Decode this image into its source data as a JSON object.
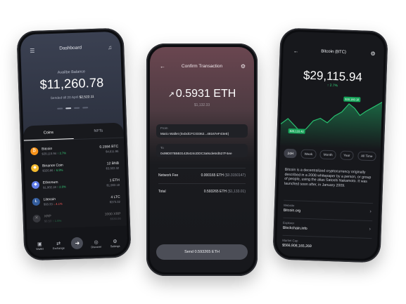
{
  "dashboard": {
    "title": "Dashboard",
    "balance_label": "Availbe Balance",
    "balance": "$11,260.78",
    "sended_prefix": "Sended till 20 April",
    "sended_amount": "$2,522.11",
    "tabs": [
      "Coins",
      "NFTs"
    ],
    "coins": [
      {
        "name": "Bitcoin",
        "price": "$29,115.94",
        "change": "↑ 2.7%",
        "dir": "up",
        "amount": "0.1584 BTC",
        "fiat": "$4,611.96",
        "icon": "₿",
        "color": "#f7931a"
      },
      {
        "name": "Binance Coin",
        "price": "$326.86",
        "change": "↑ 6.9%",
        "dir": "up",
        "amount": "12 BNB",
        "fiat": "$3,922.32",
        "icon": "◆",
        "color": "#f3ba2f"
      },
      {
        "name": "Ethereum",
        "price": "$1,902.18",
        "change": "↑ 2.0%",
        "dir": "up",
        "amount": "1 ETH",
        "fiat": "$1,902.18",
        "icon": "◆",
        "color": "#627eea"
      },
      {
        "name": "Litecoin",
        "price": "$93.33",
        "change": "↓ 4.1%",
        "dir": "dn",
        "amount": "4 LTC",
        "fiat": "$373.32",
        "icon": "Ł",
        "color": "#345d9d"
      },
      {
        "name": "XRP",
        "price": "$0.53",
        "change": "↑ 1.6%",
        "dir": "up",
        "amount": "1000 XRP",
        "fiat": "$530.00",
        "icon": "✕",
        "color": "#5c5e66"
      }
    ],
    "nav": [
      {
        "label": "Wallet",
        "icon": "wallet-icon",
        "glyph": "▣"
      },
      {
        "label": "Exchange",
        "icon": "exchange-icon",
        "glyph": "⇄"
      },
      {
        "label": "",
        "icon": "send-icon",
        "glyph": "➜"
      },
      {
        "label": "Discover",
        "icon": "discover-icon",
        "glyph": "◎"
      },
      {
        "label": "Settings",
        "icon": "settings-icon",
        "glyph": "⚙"
      }
    ]
  },
  "confirm": {
    "title": "Confirm Transaction",
    "amount": "0.5931 ETH",
    "fiat": "$1,132.33",
    "from_label": "From",
    "from_value": "Mario Wallet (0xDdCFC03362...48167eF43eE)",
    "to_label": "To",
    "to_value": "0x99D07B5B31425424cDDC3a9cde6rd527F4ee",
    "fee_label": "Network Fee",
    "fee_value": "0.000165 ETH",
    "fee_fiat": "($0.3150147)",
    "total_label": "Total",
    "total_value": "0.593265 ETH",
    "total_fiat": "($1,133.01)",
    "send_label": "Send 0.593265 ETH"
  },
  "coin_detail": {
    "title": "Bitcoin (BTC)",
    "price": "$29,115.94",
    "change": "↑ 2.7%",
    "chart_high": "$30,160.18",
    "chart_low": "$28,133.42",
    "ranges": [
      "24H",
      "Week",
      "Month",
      "Year",
      "All Time"
    ],
    "selected_range": "24H",
    "description": "Bitcoin is a decentralized cryptocurrency originally described in a 2008 whitepaper by a person, or group of people, using the alias Satoshi Nakamoto. It was launched soon after, in January 2009.",
    "website_label": "Website",
    "website_value": "Bitcoin.org",
    "explorer_label": "Explorer",
    "explorer_value": "Blockchain.info",
    "market_cap_label": "Market Cap",
    "market_cap_value": "$566,908,165,269"
  }
}
